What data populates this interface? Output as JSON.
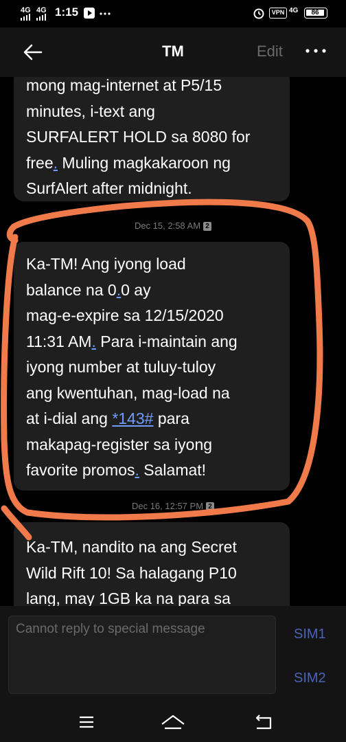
{
  "status_bar": {
    "signal_1": "4G",
    "signal_2": "4G",
    "time": "1:15",
    "vpn_label": "VPN",
    "net_label": "4G",
    "battery": "86",
    "icons": [
      "signal-icon",
      "signal-icon",
      "play-icon",
      "more-dots-icon",
      "alarm-icon",
      "vpn-icon",
      "battery-icon"
    ]
  },
  "header": {
    "title": "TM",
    "edit_label": "Edit",
    "icons": [
      "back-arrow-icon",
      "more-options-icon"
    ]
  },
  "messages": [
    {
      "text": "mong mag-internet at P5/15\nminutes, i-text ang\nSURFALERT HOLD sa 8080 for\nfree",
      "link_dot": ".",
      "text_after": " Muling magkakaroon ng\nSurfAlert after midnight",
      "text_end": "."
    },
    {
      "timestamp": "Dec 15, 2:58 AM",
      "sim_badge": "2",
      "text_a": "Ka-TM! Ang iyong load\nbalance na 0",
      "text_dot1": ".",
      "text_b": "0 ay\nmag-e-expire sa 12/15/2020\n11:31 AM",
      "text_dot2": ".",
      "text_c": " Para i-maintain ang\niyong number at tuluy-tuloy\nang kwentuhan, mag-load na\nat i-dial ang ",
      "link": "*143#",
      "text_d": " para\nmakapag-register sa iyong\nfavorite promos",
      "text_dot3": ".",
      "text_e": " Salamat!"
    },
    {
      "timestamp": "Dec 16, 12:57 PM",
      "sim_badge": "2",
      "text": "Ka-TM, nandito na ang Secret\nWild Rift 10! Sa halagang P10\nlang, may 1GB ka na para sa"
    }
  ],
  "reply": {
    "placeholder": "Cannot reply to special message",
    "sim1_label": "SIM1",
    "sim2_label": "SIM2"
  },
  "nav": {
    "icons": [
      "menu-icon",
      "home-icon",
      "back-icon"
    ]
  },
  "colors": {
    "annotation": "#f07a4a",
    "link": "#6f9cff",
    "sim": "#4a63b8"
  }
}
